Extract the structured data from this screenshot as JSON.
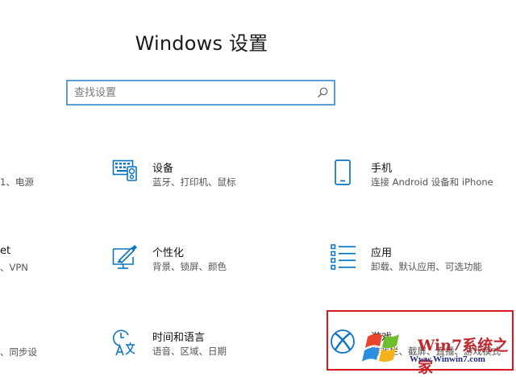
{
  "header": {
    "title": "Windows 设置"
  },
  "search": {
    "placeholder": "查找设置"
  },
  "left_partial": [
    {
      "title": "",
      "desc": "1、电源"
    },
    {
      "title": "et",
      "desc": "、VPN"
    },
    {
      "title": "",
      "desc": "、同步设"
    }
  ],
  "tiles": [
    {
      "icon": "devices-icon",
      "title": "设备",
      "desc": "蓝牙、打印机、鼠标"
    },
    {
      "icon": "phone-icon",
      "title": "手机",
      "desc": "连接 Android 设备和 iPhone"
    },
    {
      "icon": "personalization-icon",
      "title": "个性化",
      "desc": "背景、锁屏、颜色"
    },
    {
      "icon": "apps-icon",
      "title": "应用",
      "desc": "卸载、默认应用、可选功能"
    },
    {
      "icon": "time-language-icon",
      "title": "时间和语言",
      "desc": "语音、区域、日期"
    },
    {
      "icon": "xbox-icon",
      "title": "游戏",
      "desc": "游戏栏、截屏、直播、游戏模式"
    }
  ],
  "watermark": {
    "brand": "Win7系统之家",
    "url": "Www.Winwin7.com"
  },
  "colors": {
    "accent": "#0a74c4",
    "highlight": "#d9171e",
    "search_border": "#5aa0d8"
  }
}
